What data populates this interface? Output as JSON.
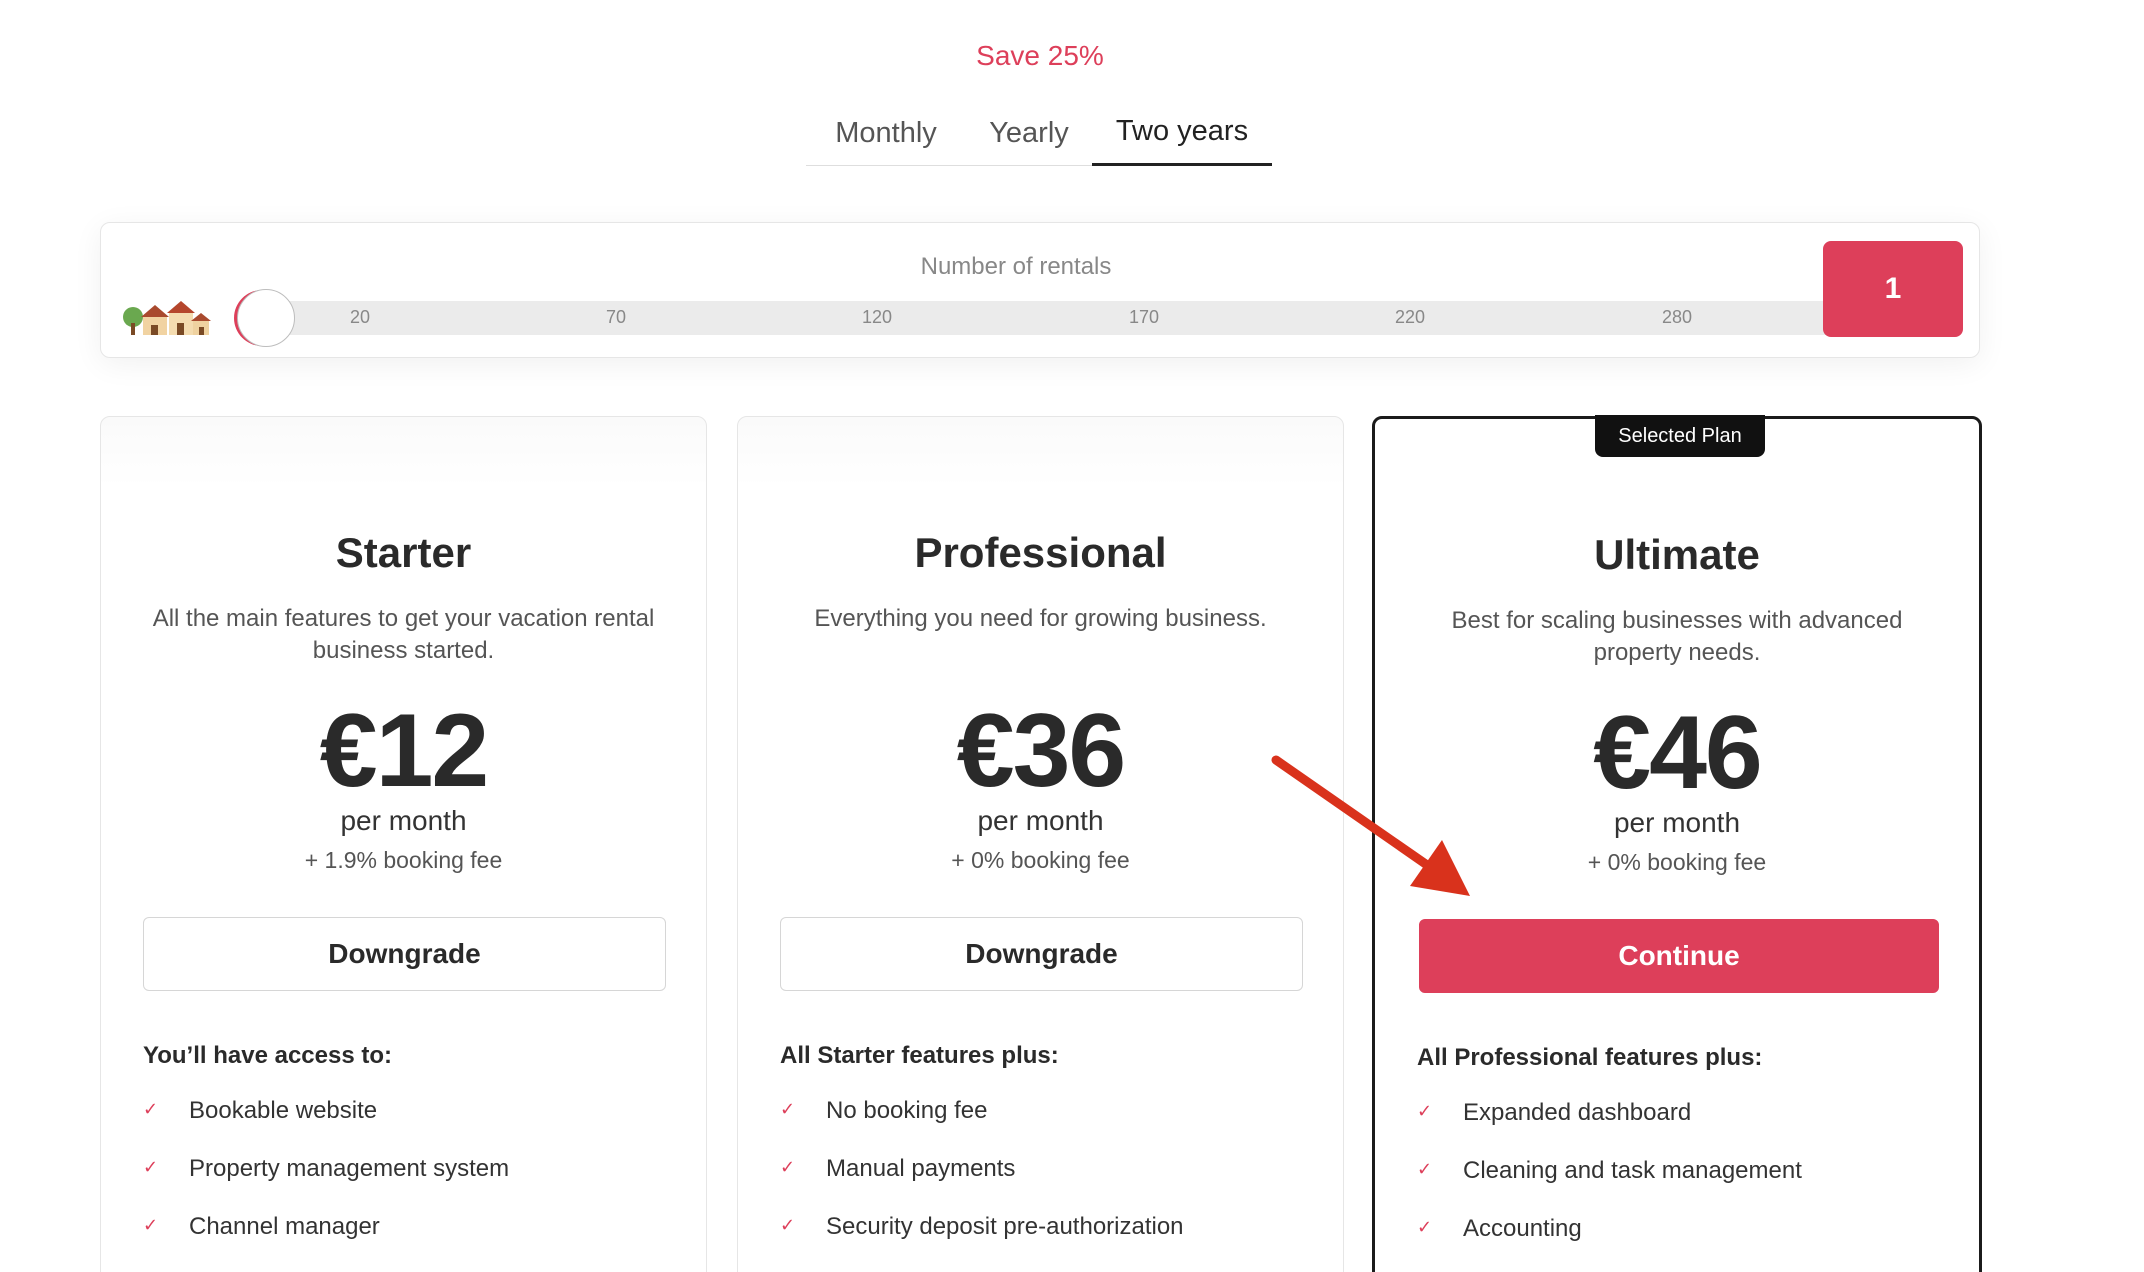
{
  "billing": {
    "save_note": "Save 25%",
    "tabs": [
      {
        "label": "Monthly",
        "selected": false
      },
      {
        "label": "Yearly",
        "selected": false
      },
      {
        "label": "Two years",
        "selected": true
      }
    ]
  },
  "rentals": {
    "label": "Number of rentals",
    "ticks": [
      "20",
      "70",
      "120",
      "170",
      "220",
      "280"
    ],
    "value": "1",
    "icon": "houses-icon"
  },
  "plans": [
    {
      "name": "Starter",
      "description": "All the main features to get your vacation rental business started.",
      "price": "€12",
      "period": "per month",
      "fee": "+ 1.9% booking fee",
      "button": "Downgrade",
      "features_heading": "You’ll have access to:",
      "features": [
        "Bookable website",
        "Property management system",
        "Channel manager"
      ]
    },
    {
      "name": "Professional",
      "description": "Everything you need for growing business.",
      "price": "€36",
      "period": "per month",
      "fee": "+ 0% booking fee",
      "button": "Downgrade",
      "features_heading": "All Starter features plus:",
      "features": [
        "No booking fee",
        "Manual payments",
        "Security deposit pre-authorization"
      ]
    },
    {
      "name": "Ultimate",
      "tag": "Selected Plan",
      "description": "Best for scaling businesses with advanced property needs.",
      "price": "€46",
      "period": "per month",
      "fee": "+ 0% booking fee",
      "button": "Continue",
      "features_heading": "All Professional features plus:",
      "features": [
        "Expanded dashboard",
        "Cleaning and task management",
        "Accounting"
      ]
    }
  ],
  "colors": {
    "accent": "#dd3f5a",
    "selected_border": "#1b1b1b",
    "annotation_arrow": "#d9321c"
  }
}
